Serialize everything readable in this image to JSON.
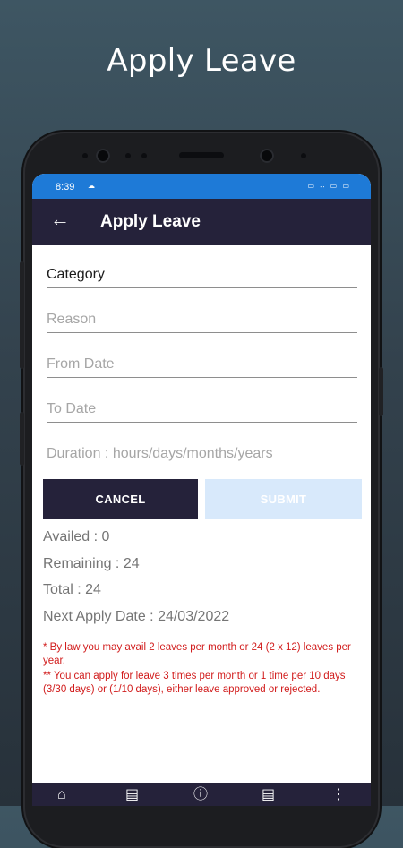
{
  "promo": {
    "headline": "Apply Leave"
  },
  "status_bar": {
    "time": "8:39",
    "notif_icon": "cloud-icon",
    "right_icons": "⌦4·∥·⌦4·▭"
  },
  "app_bar": {
    "back_icon": "←",
    "title": "Apply Leave"
  },
  "form": {
    "category_value": "Category",
    "reason_placeholder": "Reason",
    "from_date_placeholder": "From Date",
    "to_date_placeholder": "To Date",
    "duration_placeholder": "Duration : hours/days/months/years"
  },
  "buttons": {
    "cancel_label": "CANCEL",
    "submit_label": "SUBMIT"
  },
  "stats": {
    "availed": "Availed : 0",
    "remaining": "Remaining : 24",
    "total": "Total : 24",
    "next_apply_date": "Next Apply Date : 24/03/2022"
  },
  "notes": {
    "note1": "* By law you may avail 2 leaves per month or 24 (2 x 12) leaves per year.",
    "note2": "** You can apply for leave 3 times per month or 1 time per 10 days (3/30 days) or (1/10 days), either leave approved or rejected."
  },
  "bottom_nav": [
    {
      "icon": "home-icon",
      "glyph": "⌂"
    },
    {
      "icon": "calendar-icon",
      "glyph": "▤"
    },
    {
      "icon": "info-icon",
      "glyph": "ⓘ"
    },
    {
      "icon": "list-icon",
      "glyph": "▤"
    },
    {
      "icon": "more-vert-icon",
      "glyph": "⋮"
    }
  ],
  "colors": {
    "app_bar": "#25223a",
    "status_bar": "#1e7ad7",
    "warning_text": "#d11b1b",
    "submit_disabled": "#d8e9fb"
  }
}
